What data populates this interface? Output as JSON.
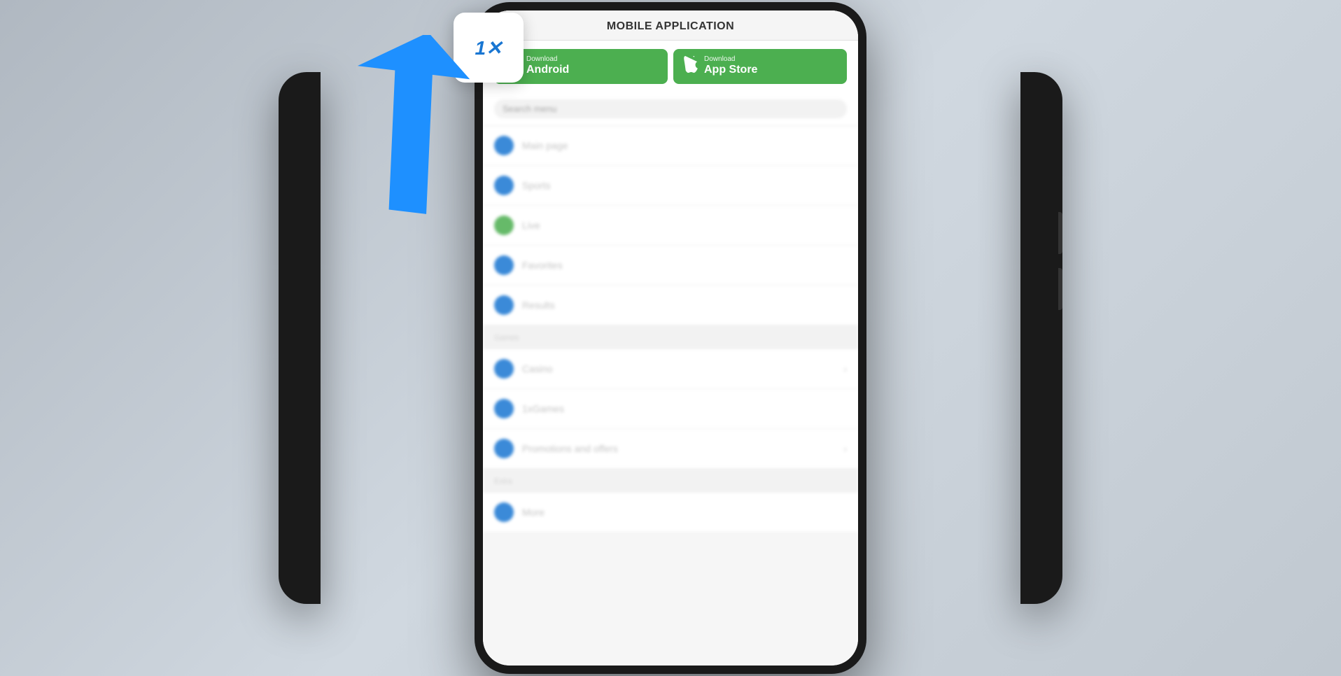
{
  "scene": {
    "background_color": "#c5cdd6"
  },
  "popup": {
    "title": "MOBILE APPLICATION",
    "android_btn": {
      "small_label": "Download",
      "large_label": "Android"
    },
    "appstore_btn": {
      "small_label": "Download",
      "large_label": "App Store"
    }
  },
  "menu": {
    "search_placeholder": "Search menu",
    "items": [
      {
        "label": "Main page",
        "icon_type": "blue"
      },
      {
        "label": "Sports",
        "icon_type": "blue"
      },
      {
        "label": "Live",
        "icon_type": "green"
      },
      {
        "label": "Favorites",
        "icon_type": "blue"
      },
      {
        "label": "Results",
        "icon_type": "blue"
      }
    ],
    "sections": [
      {
        "label": "Games",
        "items": [
          {
            "label": "Casino",
            "icon_type": "blue",
            "has_chevron": true
          },
          {
            "label": "1xGames",
            "icon_type": "blue",
            "has_chevron": false
          },
          {
            "label": "Promotions and offers",
            "icon_type": "blue",
            "has_chevron": true
          }
        ]
      },
      {
        "label": "Extra",
        "items": [
          {
            "label": "More",
            "icon_type": "blue",
            "has_chevron": false
          }
        ]
      }
    ]
  },
  "logo": {
    "text": "1✕"
  },
  "arrow": {
    "color": "#1e90ff",
    "direction": "up-right"
  }
}
